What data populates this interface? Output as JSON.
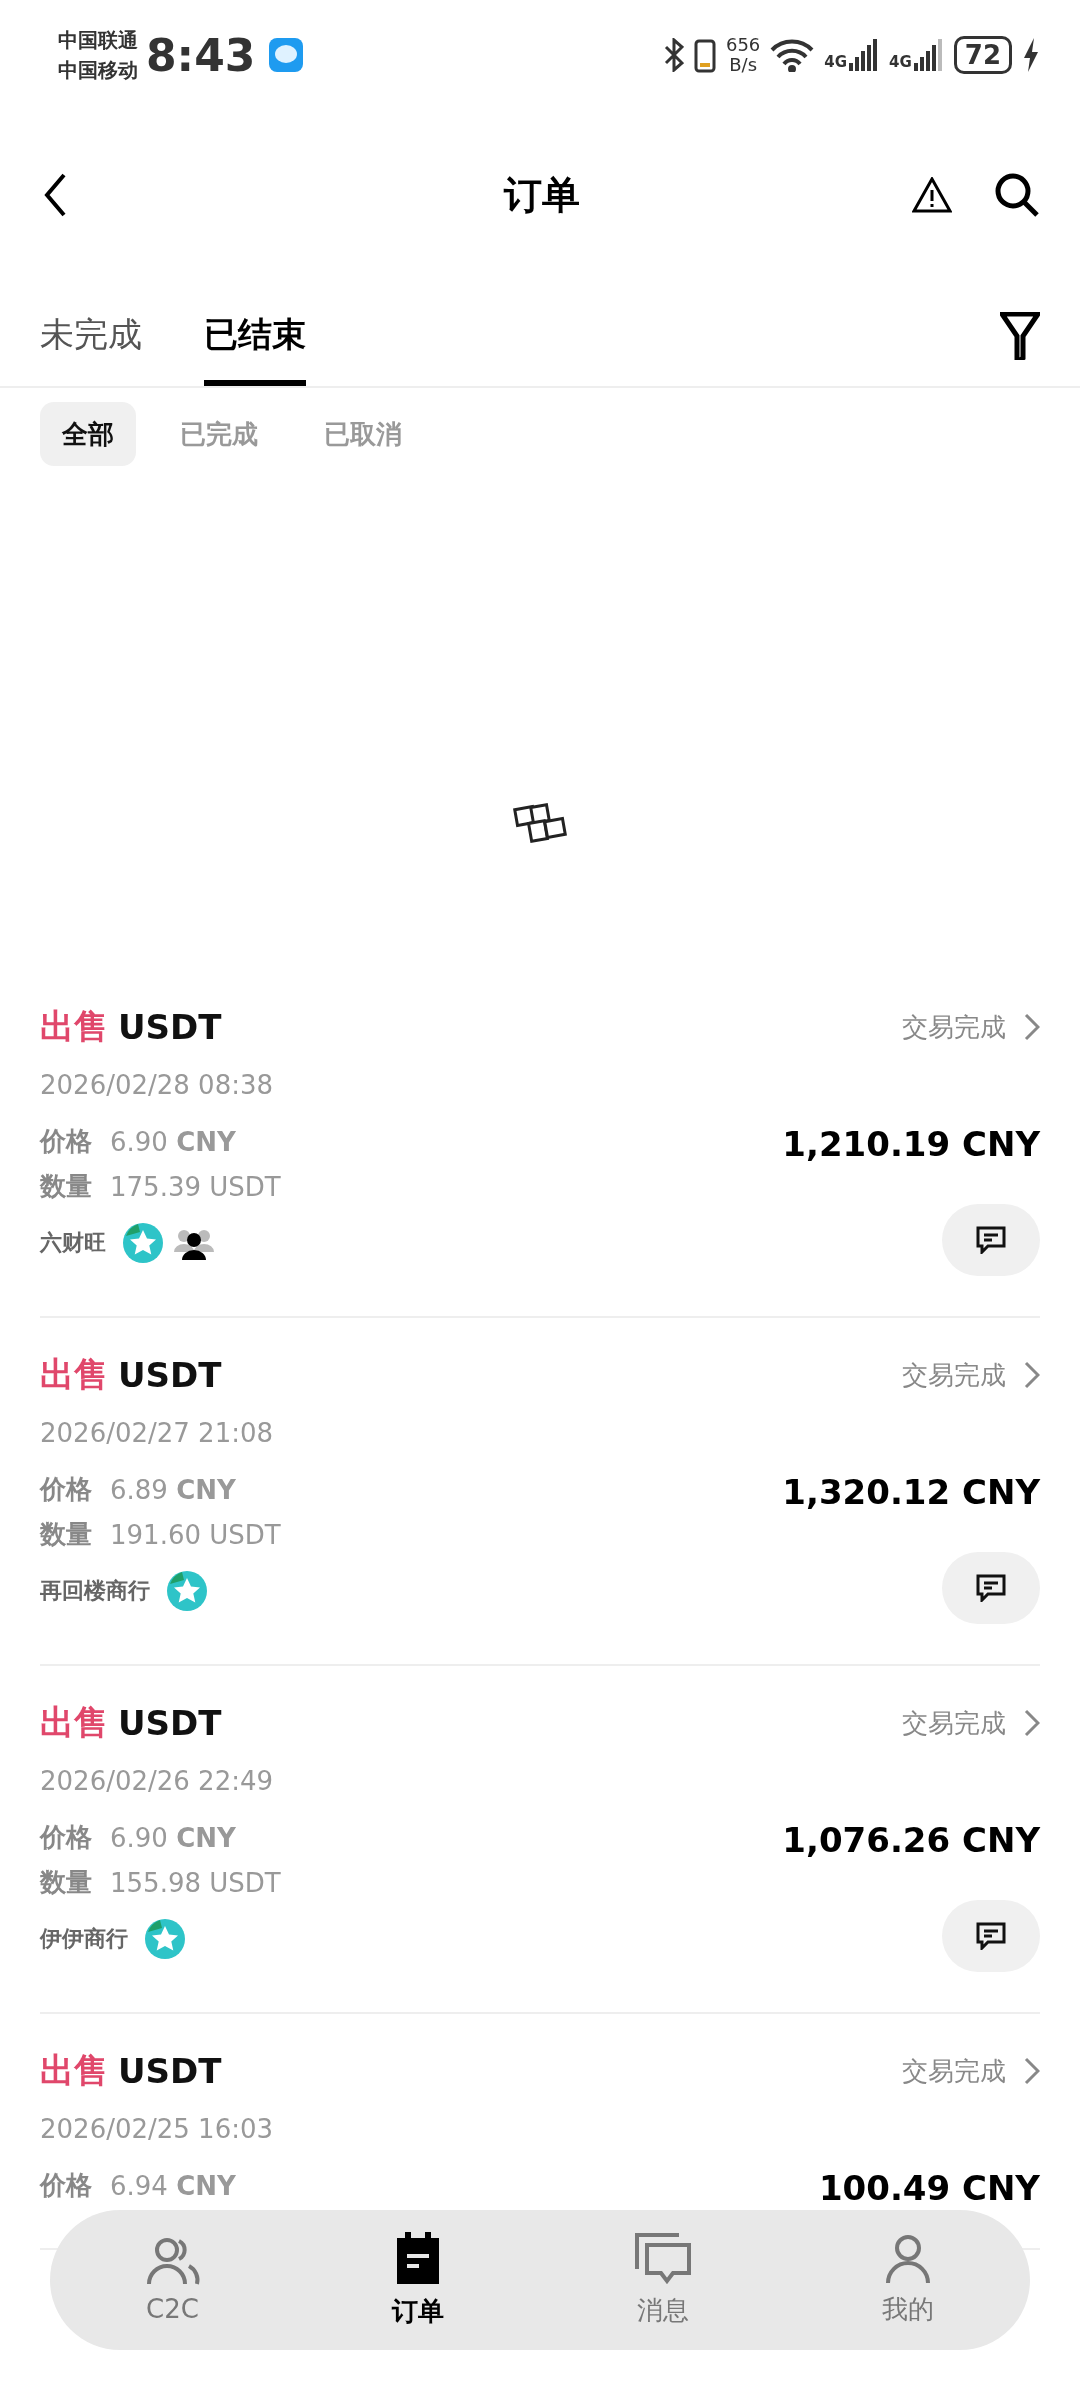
{
  "status_bar": {
    "carriers": [
      "中国联通",
      "中国移动"
    ],
    "time": "8:43",
    "net_speed": [
      "656",
      "B/s"
    ],
    "network_labels": [
      "4G",
      "4G"
    ],
    "battery": "72"
  },
  "header": {
    "title": "订单"
  },
  "tabs": [
    {
      "label": "未完成",
      "selected": false
    },
    {
      "label": "已结束",
      "selected": true
    }
  ],
  "filters": [
    {
      "label": "全部",
      "selected": true
    },
    {
      "label": "已完成",
      "selected": false
    },
    {
      "label": "已取消",
      "selected": false
    }
  ],
  "orders": [
    {
      "side": "出售",
      "asset": "USDT",
      "status": "交易完成",
      "date": "2026/02/28 08:38",
      "price_label": "价格",
      "price": "6.90",
      "price_unit": "CNY",
      "qty_label": "数量",
      "qty": "175.39 USDT",
      "merchant": "六财旺",
      "badges": [
        {
          "kind": "star"
        },
        {
          "kind": "group"
        }
      ],
      "total": "1,210.19 CNY"
    },
    {
      "side": "出售",
      "asset": "USDT",
      "status": "交易完成",
      "date": "2026/02/27 21:08",
      "price_label": "价格",
      "price": "6.89",
      "price_unit": "CNY",
      "qty_label": "数量",
      "qty": "191.60 USDT",
      "merchant": "再回楼商行",
      "badges": [
        {
          "kind": "star"
        }
      ],
      "total": "1,320.12 CNY"
    },
    {
      "side": "出售",
      "asset": "USDT",
      "status": "交易完成",
      "date": "2026/02/26 22:49",
      "price_label": "价格",
      "price": "6.90",
      "price_unit": "CNY",
      "qty_label": "数量",
      "qty": "155.98 USDT",
      "merchant": "伊伊商行",
      "badges": [
        {
          "kind": "star"
        }
      ],
      "total": "1,076.26 CNY"
    },
    {
      "side": "出售",
      "asset": "USDT",
      "status": "交易完成",
      "date": "2026/02/25 16:03",
      "price_label": "价格",
      "price": "6.94",
      "price_unit": "CNY",
      "total": "100.49 CNY"
    }
  ],
  "bottom_nav": [
    {
      "kind": "people",
      "label": "C2C",
      "selected": false
    },
    {
      "kind": "orders",
      "label": "订单",
      "selected": true
    },
    {
      "kind": "chat",
      "label": "消息",
      "selected": false
    },
    {
      "kind": "person",
      "label": "我的",
      "selected": false
    }
  ]
}
